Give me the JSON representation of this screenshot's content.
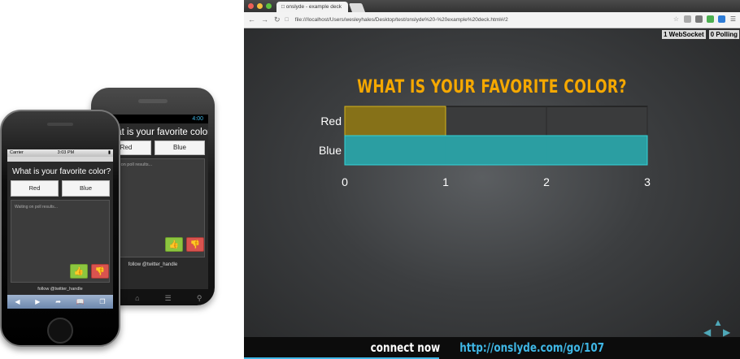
{
  "android": {
    "time": "4:00",
    "question": "What is your favorite color?",
    "option_red": "Red",
    "option_blue": "Blue",
    "waiting": "Waiting on poll results...",
    "follow": "follow @twitter_handle"
  },
  "iphone": {
    "carrier": "Carrier",
    "time": "3:03 PM",
    "question": "What is your favorite color?",
    "option_red": "Red",
    "option_blue": "Blue",
    "waiting": "Waiting on poll results...",
    "follow": "follow @twitter_handle"
  },
  "browser": {
    "tab_title": "onslyde - example deck",
    "url": "file:///localhost/Users/wesleyhales/Desktop/test/onslyde%20-%20example%20deck.html#/2",
    "websocket_count": "1 WebSocket",
    "polling_count": "0 Polling"
  },
  "slide": {
    "title": "WHAT IS YOUR FAVORITE COLOR?",
    "connect_text": "connect now",
    "connect_url": "http://onslyde.com/go/107"
  },
  "colors": {
    "title": "#f5a800",
    "red_bar": "#8a7416",
    "blue_bar": "#2aa3a8",
    "url_link": "#3fb7e6",
    "thumb_up": "#8cc63f",
    "thumb_down": "#d9534f"
  },
  "chart_data": {
    "type": "bar",
    "orientation": "horizontal",
    "categories": [
      "Red",
      "Blue"
    ],
    "values": [
      1,
      3
    ],
    "xlim": [
      0,
      3
    ],
    "xticks": [
      "0",
      "1",
      "2",
      "3"
    ],
    "title": "",
    "xlabel": "",
    "ylabel": "",
    "grid": true
  }
}
